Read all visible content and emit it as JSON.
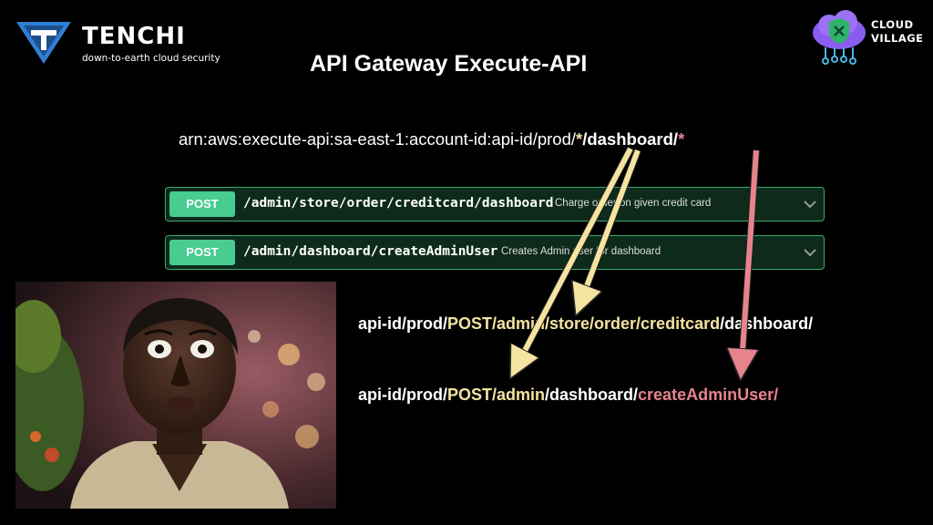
{
  "logos": {
    "tenchi": {
      "name": "TENCHI",
      "tagline": "down-to-earth cloud security",
      "icon": "tenchi-triangle-icon"
    },
    "cloud_village": {
      "line1": "CLOUD",
      "line2": "VILLAGE",
      "icon": "cloud-shield-icon"
    }
  },
  "title": "API Gateway Execute-API",
  "arn": {
    "prefix": "arn:aws:execute-api:sa-east-1:account-id:api-id/prod/",
    "star1": "*",
    "middle": "/dashboard/",
    "star2": "*"
  },
  "endpoints": [
    {
      "method": "POST",
      "path": "/admin/store/order/creditcard/dashboard",
      "description": "Charge order on given credit card"
    },
    {
      "method": "POST",
      "path": "/admin/dashboard/createAdminUser",
      "description": "Creates Admin user for dashboard"
    }
  ],
  "resources": [
    {
      "prefix": "api-id/prod/",
      "highlight": "POST/admin/store/order/creditcard",
      "rest": "/dashboard/"
    },
    {
      "prefix": "api-id/prod/",
      "highlight": "POST/admin",
      "middle": "/dashboard/",
      "pink": "createAdminUser/"
    }
  ],
  "colors": {
    "background": "#000000",
    "yellow_highlight": "#f5e3a1",
    "pink_highlight": "#e7838d",
    "swagger_post_green": "#49cc90",
    "tenchi_blue": "#2f7fd4",
    "cloud_village_purple": "#8a5cf0"
  },
  "photo": {
    "description_icon": "surprised-person-photo"
  }
}
